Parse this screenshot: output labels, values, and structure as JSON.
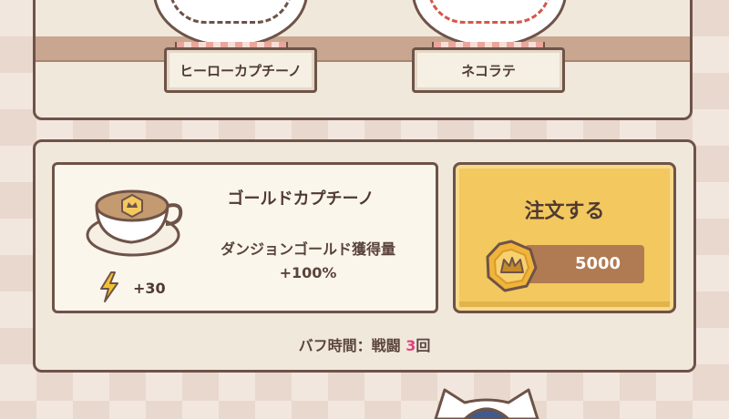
{
  "shelf": {
    "items": [
      {
        "name": "ヒーローカプチーノ"
      },
      {
        "name": "ネコラテ"
      }
    ]
  },
  "selected_item": {
    "name": "ゴールドカプチーノ",
    "effect_line1": "ダンジョンゴールド獲得量",
    "effect_line2": "+100%",
    "energy": "+30"
  },
  "order": {
    "label": "注文する",
    "price": "5000"
  },
  "buff": {
    "prefix": "バフ時間：戦闘",
    "count": "3",
    "suffix": "回"
  },
  "icons": {
    "energy": "lightning-bolt-icon",
    "coin": "gold-crown-coin-icon",
    "cup": "gold-cappuccino-cup-icon"
  },
  "colors": {
    "accent_button": "#f3c85f",
    "outline": "#6e5348",
    "buff_count": "#e0427e",
    "price_bar": "#b07a52"
  }
}
